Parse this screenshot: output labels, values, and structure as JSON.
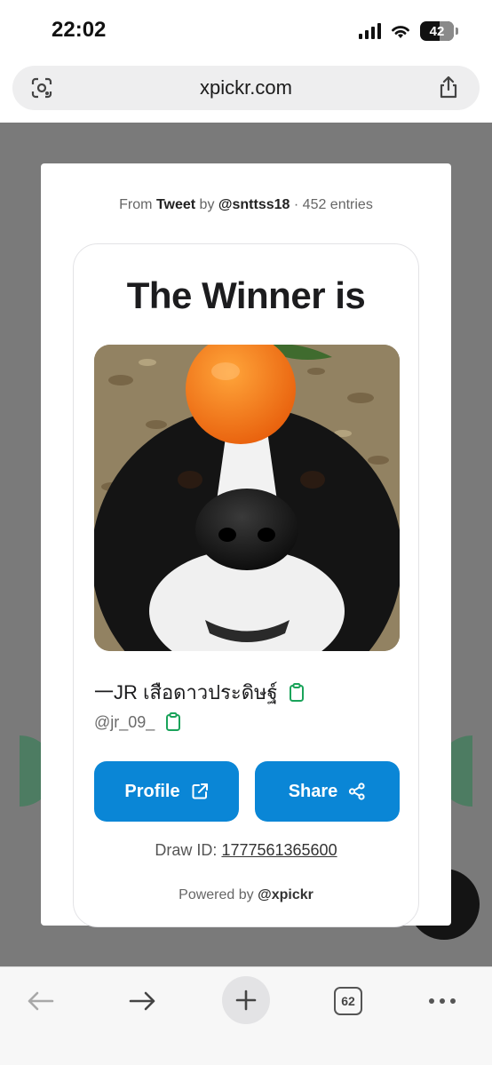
{
  "status": {
    "time": "22:02",
    "battery": "42"
  },
  "browser": {
    "url": "xpickr.com",
    "tab_count": "62"
  },
  "modal": {
    "from_prefix": "From",
    "source": "Tweet",
    "by": "by",
    "author": "@snttss18",
    "entries": "· 452 entries",
    "title": "The Winner is",
    "winner_name": "一JR เสือดาวประดิษฐ์",
    "winner_handle": "@jr_09_",
    "profile_label": "Profile",
    "share_label": "Share",
    "draw_label": "Draw ID:",
    "draw_id": "1777561365600",
    "powered_prefix": "Powered by",
    "powered_brand": "@xpickr"
  },
  "colors": {
    "accent": "#0a86d6",
    "clipboard": "#1aa35a",
    "backdrop": "#7a7a7a"
  },
  "icons": {
    "url_left": "screenshot-lens-icon",
    "url_right": "share-icon",
    "profile": "external-link-icon",
    "share": "share-nodes-icon",
    "copy": "clipboard-icon"
  }
}
